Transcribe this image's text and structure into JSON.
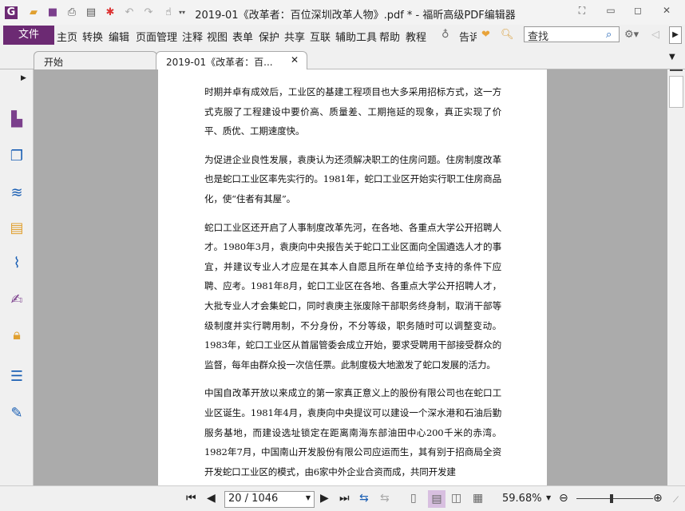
{
  "window": {
    "title": "2019-01《改革者：百位深圳改革人物》.pdf * - 福昕高级PDF编辑器"
  },
  "menu": {
    "file": "文件",
    "items": [
      "主页",
      "转换",
      "编辑",
      "页面管理",
      "注释",
      "视图",
      "表单",
      "保护",
      "共享",
      "互联",
      "辅助工具",
      "帮助",
      "教程"
    ],
    "tell": "告诉",
    "search_placeholder": "查找"
  },
  "tabs": [
    {
      "label": "开始"
    },
    {
      "label": "2019-01《改革者：百..."
    }
  ],
  "document": {
    "paragraphs": [
      "时期并卓有成效后，工业区的基建工程项目也大多采用招标方式，这一方式克服了工程建设中要价高、质量差、工期拖延的现象，真正实现了价平、质优、工期速度快。",
      "为促进企业良性发展，袁庚认为还须解决职工的住房问题。住房制度改革也是蛇口工业区率先实行的。1981年，蛇口工业区开始实行职工住房商品化，使“住者有其屋”。",
      "蛇口工业区还开启了人事制度改革先河，在各地、各重点大学公开招聘人才。1980年3月，袁庚向中央报告关于蛇口工业区面向全国遴选人才的事宜，并建议专业人才应是在其本人自愿且所在单位给予支持的条件下应聘、应考。1981年8月，蛇口工业区在各地、各重点大学公开招聘人才，大批专业人才会集蛇口，同时袁庚主张废除干部职务终身制，取消干部等级制度并实行聘用制，不分身份，不分等级，职务随时可以调整变动。1983年，蛇口工业区从首届管委会成立开始，要求受聘用干部接受群众的监督，每年由群众投一次信任票。此制度极大地激发了蛇口发展的活力。",
      "中国自改革开放以来成立的第一家真正意义上的股份有限公司也在蛇口工业区诞生。1981年4月，袁庚向中央提议可以建设一个深水港和石油后勤服务基地，而建设选址锁定在距离南海东部油田中心200千米的赤湾。1982年7月，中国南山开发股份有限公司应运而生，其有别于招商局全资开发蛇口工业区的模式，由6家中外企业合资而成，共同开发建"
    ]
  },
  "status": {
    "page": "20 / 1046",
    "zoom": "59.68%",
    "zoom_fraction": 0.6
  },
  "colors": {
    "accent": "#6c2a73"
  }
}
